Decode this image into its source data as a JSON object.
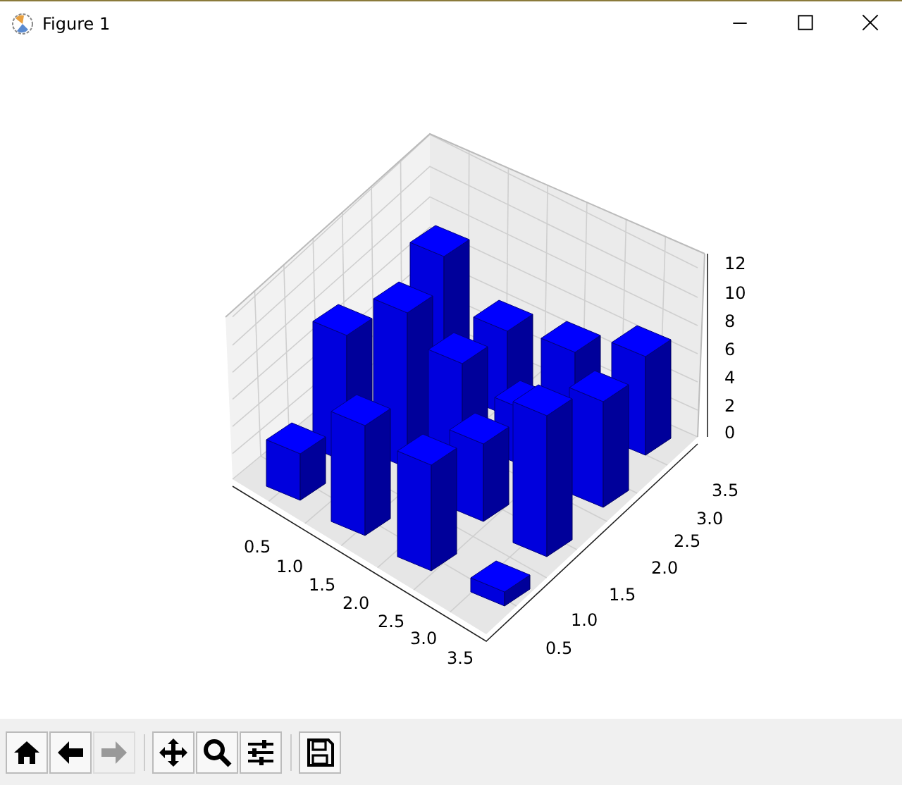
{
  "window": {
    "title": "Figure 1"
  },
  "figure": {
    "kind": "bar3d",
    "z_ticks": [
      "12",
      "10",
      "8",
      "6",
      "4",
      "2",
      "0"
    ],
    "x_ticks": [
      "0.5",
      "1.0",
      "1.5",
      "2.0",
      "2.5",
      "3.0",
      "3.5"
    ],
    "y_ticks": [
      "0.5",
      "1.0",
      "1.5",
      "2.0",
      "2.5",
      "3.0",
      "3.5"
    ]
  },
  "toolbar": {
    "groups": [
      [
        {
          "kind": "home",
          "disabled": false
        },
        {
          "kind": "back",
          "disabled": false
        },
        {
          "kind": "forward",
          "disabled": true
        }
      ],
      [
        {
          "kind": "pan",
          "disabled": false
        },
        {
          "kind": "zoom",
          "disabled": false
        },
        {
          "kind": "configure",
          "disabled": false
        }
      ],
      [
        {
          "kind": "save",
          "disabled": false
        }
      ]
    ]
  }
}
